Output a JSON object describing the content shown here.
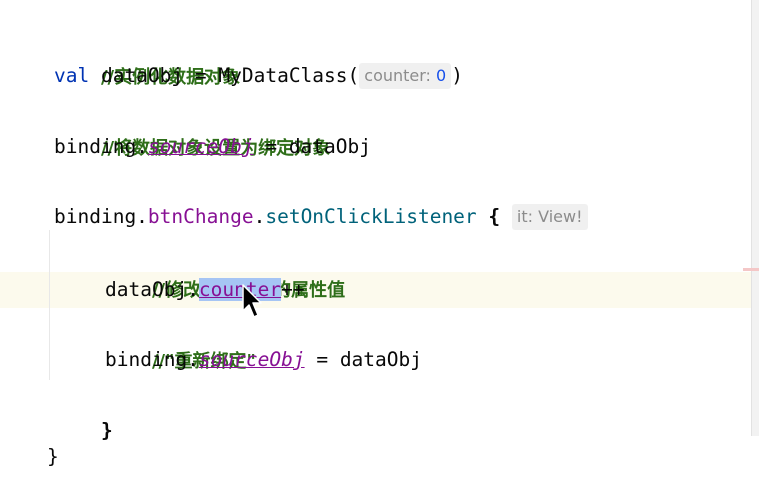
{
  "editor": {
    "lines": [
      {
        "comment": "//实例化数据对象"
      },
      {
        "keyword": "val",
        "var": " dataObj = MyDataClass(",
        "hint_label": "counter: ",
        "hint_value": "0",
        "close": ")"
      },
      {
        "comment": "//将数据对象设置为绑定对象"
      },
      {
        "receiver": "binding.",
        "property": "sourceObj",
        "rest": " = dataObj"
      },
      {
        "receiver": "binding.",
        "field": "btnChange",
        "dot": ".",
        "method": "setOnClickListener",
        "space": " ",
        "brace_open": "{",
        "hint": "it: View!"
      },
      {
        "comment": "//修改数据对象的属性值"
      },
      {
        "receiver": "dataObj.",
        "selected": "counter",
        "rest": "++"
      },
      {
        "comment": "//\"重新绑定\""
      },
      {
        "receiver": "binding.",
        "property": "sourceObj",
        "rest": " = dataObj"
      },
      {
        "brace_close": "}"
      },
      {
        "outer_brace": "}"
      }
    ]
  },
  "colors": {
    "comment": "#2e6e19",
    "keyword": "#0033b3",
    "property": "#871094",
    "method": "#00627a",
    "number": "#1750eb",
    "selection": "#a6c5f4",
    "caret_line": "#fcfaed"
  },
  "icons": {
    "cursor": "mouse-pointer-icon"
  }
}
